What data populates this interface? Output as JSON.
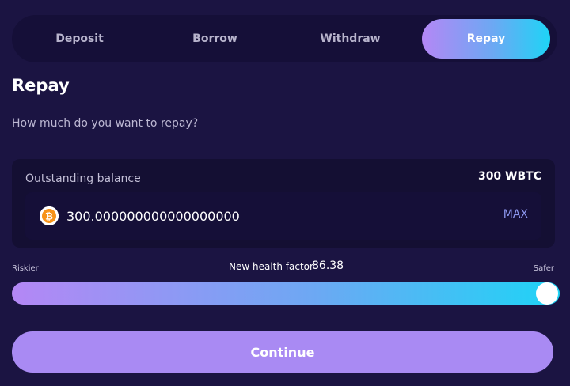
{
  "tabs": [
    {
      "label": "Deposit"
    },
    {
      "label": "Borrow"
    },
    {
      "label": "Withdraw"
    },
    {
      "label": "Repay",
      "active": true
    }
  ],
  "title": "Repay",
  "subtitle": "How much do you want to repay?",
  "balance": {
    "label": "Outstanding balance",
    "value": "300 WBTC",
    "amount": "300.000000000000000000",
    "token_icon": "bitcoin-icon",
    "max_label": "MAX"
  },
  "health": {
    "riskier_label": "Riskier",
    "safer_label": "Safer",
    "label": "New health factor",
    "value": "86.38",
    "slider_level": 1.0
  },
  "continue_label": "Continue",
  "colors": {
    "background": "#1b1442",
    "gradient_start": "#b487f5",
    "gradient_end": "#1ed4f6",
    "button": "#a98af3",
    "bitcoin": "#f7931a"
  }
}
